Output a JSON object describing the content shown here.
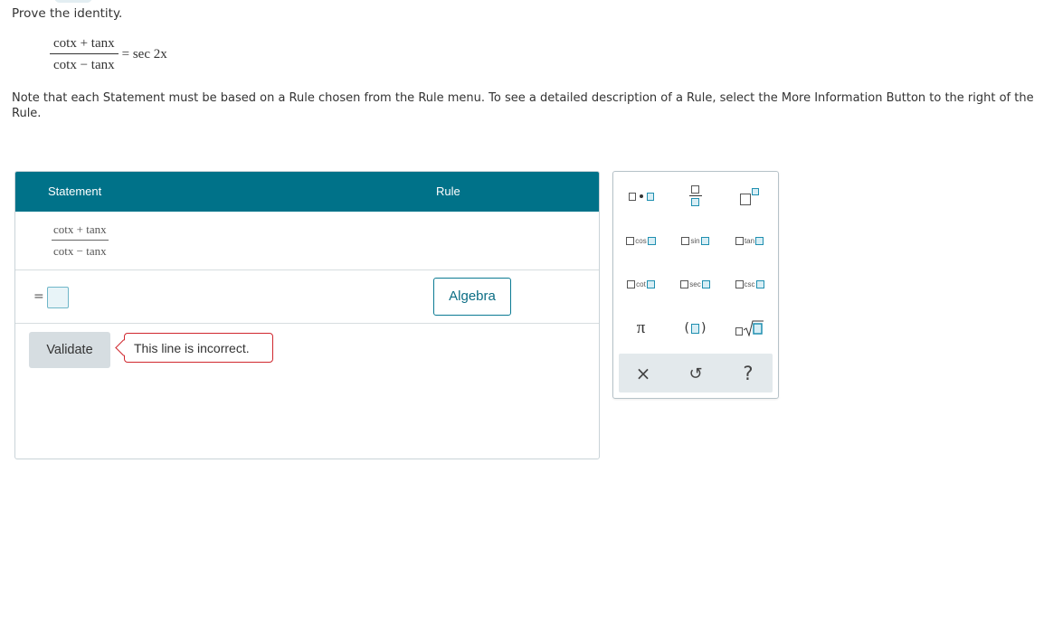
{
  "problem": {
    "prompt": "Prove the identity.",
    "identity": {
      "numerator": "cotx + tanx",
      "denominator": "cotx − tanx",
      "rhs": "= sec 2x"
    }
  },
  "note": "Note that each Statement must be based on a Rule chosen from the Rule menu. To see a detailed description of a Rule, select the More Information Button to the right of the Rule.",
  "proof_table": {
    "header_statement": "Statement",
    "header_rule": "Rule",
    "row1": {
      "numerator": "cotx + tanx",
      "denominator": "cotx − tanx"
    },
    "row2": {
      "equals": "=",
      "rule_button": "Algebra"
    },
    "validate_label": "Validate",
    "error_message": "This line is incorrect."
  },
  "palette": {
    "functions": [
      "cos",
      "sin",
      "tan",
      "cot",
      "sec",
      "csc"
    ],
    "pi": "π",
    "paren_open": "(",
    "paren_close": ")",
    "clear": "×",
    "undo": "↺",
    "help": "?"
  },
  "colors": {
    "header_bg": "#007289",
    "accent": "#1f8fb0",
    "error": "#d0272e",
    "validate_bg": "#d6dde1"
  },
  "icons": [
    "dot-product-icon",
    "fraction-icon",
    "superscript-icon",
    "pi-icon",
    "parentheses-icon",
    "sqrt-icon",
    "clear-icon",
    "undo-icon",
    "help-icon"
  ]
}
